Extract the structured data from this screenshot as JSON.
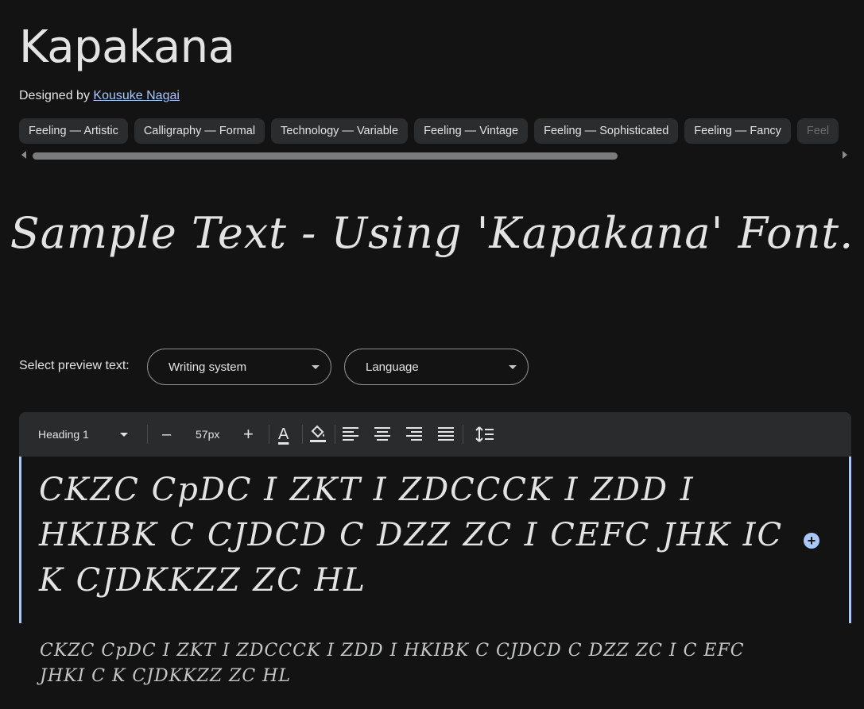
{
  "font": {
    "name": "Kapakana",
    "designer_prefix": "Designed by",
    "designer_name": "Kousuke Nagai"
  },
  "tags": [
    "Feeling — Artistic",
    "Calligraphy — Formal",
    "Technology — Variable",
    "Feeling — Vintage",
    "Feeling — Sophisticated",
    "Feeling — Fancy",
    "Feel"
  ],
  "hero_sample": "Sample Text - Using 'Kapakana' Font.",
  "preview": {
    "label": "Select preview text:",
    "writing_system": "Writing system",
    "language": "Language"
  },
  "toolbar": {
    "style": "Heading 1",
    "decrease": "–",
    "size": "57px",
    "increase": "+",
    "text_color_glyph": "A"
  },
  "editor_text": "CKZC CpDC I ZKT I ZDCCCK I ZDD I HKIBK C CJDCD C DZZ ZC I CEFC JHK IC K CJDKKZZ ZC HL",
  "small_sample": "CKZC CpDC I ZKT I ZDCCCK I ZDD I HKIBK C CJDCD C DZZ ZC I C EFC JHKI C K CJDKKZZ ZC HL",
  "colors": {
    "background": "#131314",
    "accent": "#a8c7fa",
    "chip": "#2b2c2e"
  }
}
